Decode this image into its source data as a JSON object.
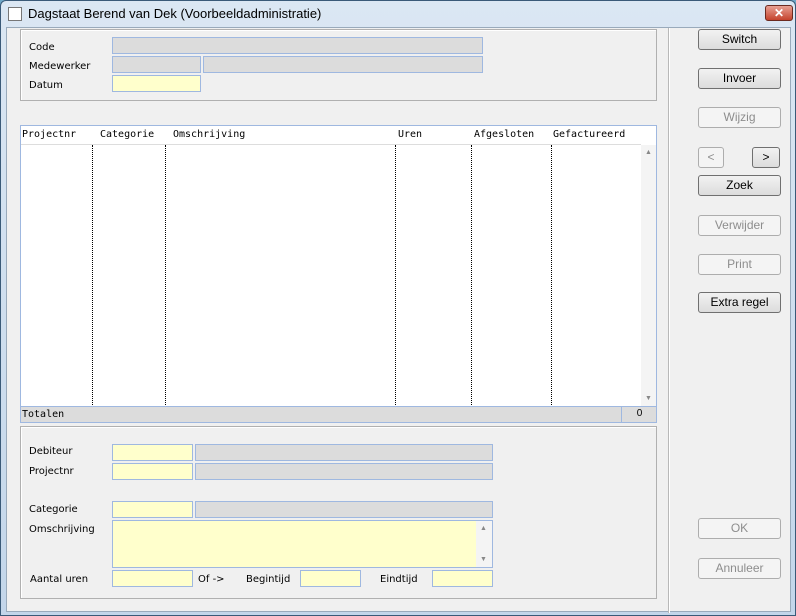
{
  "window": {
    "title": "Dagstaat Berend van Dek (Voorbeeldadministratie)",
    "close_glyph": "✕"
  },
  "header": {
    "code_label": "Code",
    "medewerker_label": "Medewerker",
    "datum_label": "Datum"
  },
  "table": {
    "columns": [
      "Projectnr",
      "Categorie",
      "Omschrijving",
      "Uren",
      "Afgesloten",
      "Gefactureerd"
    ],
    "rows": [],
    "totals_label": "Totalen",
    "totals_value": "0"
  },
  "detail": {
    "debiteur_label": "Debiteur",
    "projectnr_label": "Projectnr",
    "categorie_label": "Categorie",
    "omschrijving_label": "Omschrijving",
    "aantal_uren_label": "Aantal uren",
    "of_label": "Of ->",
    "begintijd_label": "Begintijd",
    "eindtijd_label": "Eindtijd"
  },
  "buttons": {
    "switch": "Switch",
    "invoer": "Invoer",
    "wijzig": "Wijzig",
    "prev": "<",
    "next": ">",
    "zoek": "Zoek",
    "verwijder": "Verwijder",
    "print": "Print",
    "extra_regel": "Extra regel",
    "ok": "OK",
    "annuleer": "Annuleer"
  },
  "colors": {
    "input_required": "#ffffcc",
    "input_readonly": "#dcdcdc",
    "field_border": "#9fb8e0"
  }
}
